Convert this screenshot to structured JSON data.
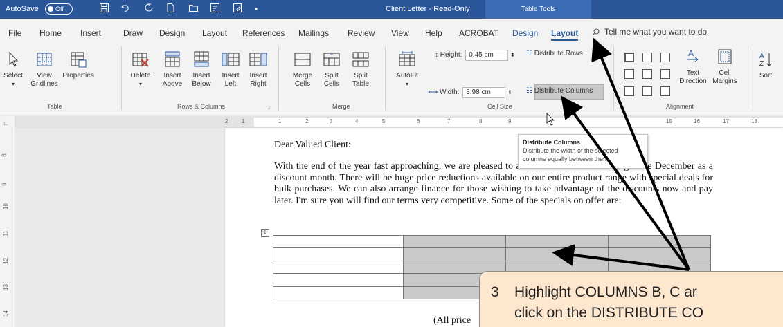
{
  "titlebar": {
    "autosave_label": "AutoSave",
    "autosave_state": "Off",
    "document_title": "Client Letter  -  Read-Only",
    "context_tab_group": "Table Tools"
  },
  "ribbon_tabs": {
    "file": "File",
    "home": "Home",
    "insert": "Insert",
    "draw": "Draw",
    "design": "Design",
    "layout": "Layout",
    "references": "References",
    "mailings": "Mailings",
    "review": "Review",
    "view": "View",
    "help": "Help",
    "acrobat": "ACROBAT",
    "table_design": "Design",
    "table_layout": "Layout",
    "tell_me": "Tell me what you want to do"
  },
  "ribbon": {
    "table_group": {
      "label": "Table",
      "select": "Select",
      "view_gridlines_1": "View",
      "view_gridlines_2": "Gridlines",
      "properties": "Properties"
    },
    "rows_cols_group": {
      "label": "Rows & Columns",
      "delete": "Delete",
      "insert_above_1": "Insert",
      "insert_above_2": "Above",
      "insert_below_1": "Insert",
      "insert_below_2": "Below",
      "insert_left_1": "Insert",
      "insert_left_2": "Left",
      "insert_right_1": "Insert",
      "insert_right_2": "Right"
    },
    "merge_group": {
      "label": "Merge",
      "merge_cells_1": "Merge",
      "merge_cells_2": "Cells",
      "split_cells_1": "Split",
      "split_cells_2": "Cells",
      "split_table_1": "Split",
      "split_table_2": "Table"
    },
    "cell_size_group": {
      "label": "Cell Size",
      "autofit": "AutoFit",
      "height_label": "Height:",
      "height_value": "0.45 cm",
      "width_label": "Width:",
      "width_value": "3.98 cm",
      "distribute_rows": "Distribute Rows",
      "distribute_columns": "Distribute Columns"
    },
    "alignment_group": {
      "label": "Alignment",
      "text_direction_1": "Text",
      "text_direction_2": "Direction",
      "cell_margins_1": "Cell",
      "cell_margins_2": "Margins"
    },
    "data_group": {
      "sort": "Sort"
    }
  },
  "ruler": {
    "top_numbers": [
      "2",
      "1",
      "1",
      "2",
      "3",
      "4",
      "5",
      "6",
      "7",
      "8",
      "9",
      "15",
      "16",
      "17",
      "18"
    ],
    "left_numbers": [
      "8",
      "9",
      "10",
      "11",
      "12",
      "13",
      "14"
    ]
  },
  "tooltip": {
    "title": "Distribute Columns",
    "line1": "Distribute the width of the selected",
    "line2": "columns equally between them."
  },
  "document": {
    "salutation": "Dear Valued Client:",
    "paragraph": "With the end of the year fast approaching, we are pleased to announce that we are setting aside December as a discount month.  There will be huge price reductions available on our entire product range with special deals for bulk purchases.  We can also arrange finance for those wishing to take advantage of the discounts now and pay later.  I'm sure you will find our terms very competitive.  Some of the specials on offer are:",
    "table_rows": 5,
    "footnote": "(All price"
  },
  "callout": {
    "step": "3",
    "line1": "Highlight COLUMNS B, C ar",
    "line2": "click on the DISTRIBUTE CO"
  },
  "colors": {
    "word_blue": "#2b579a",
    "selection_grey": "#c9c9c9",
    "callout_bg": "#fde8cf"
  }
}
